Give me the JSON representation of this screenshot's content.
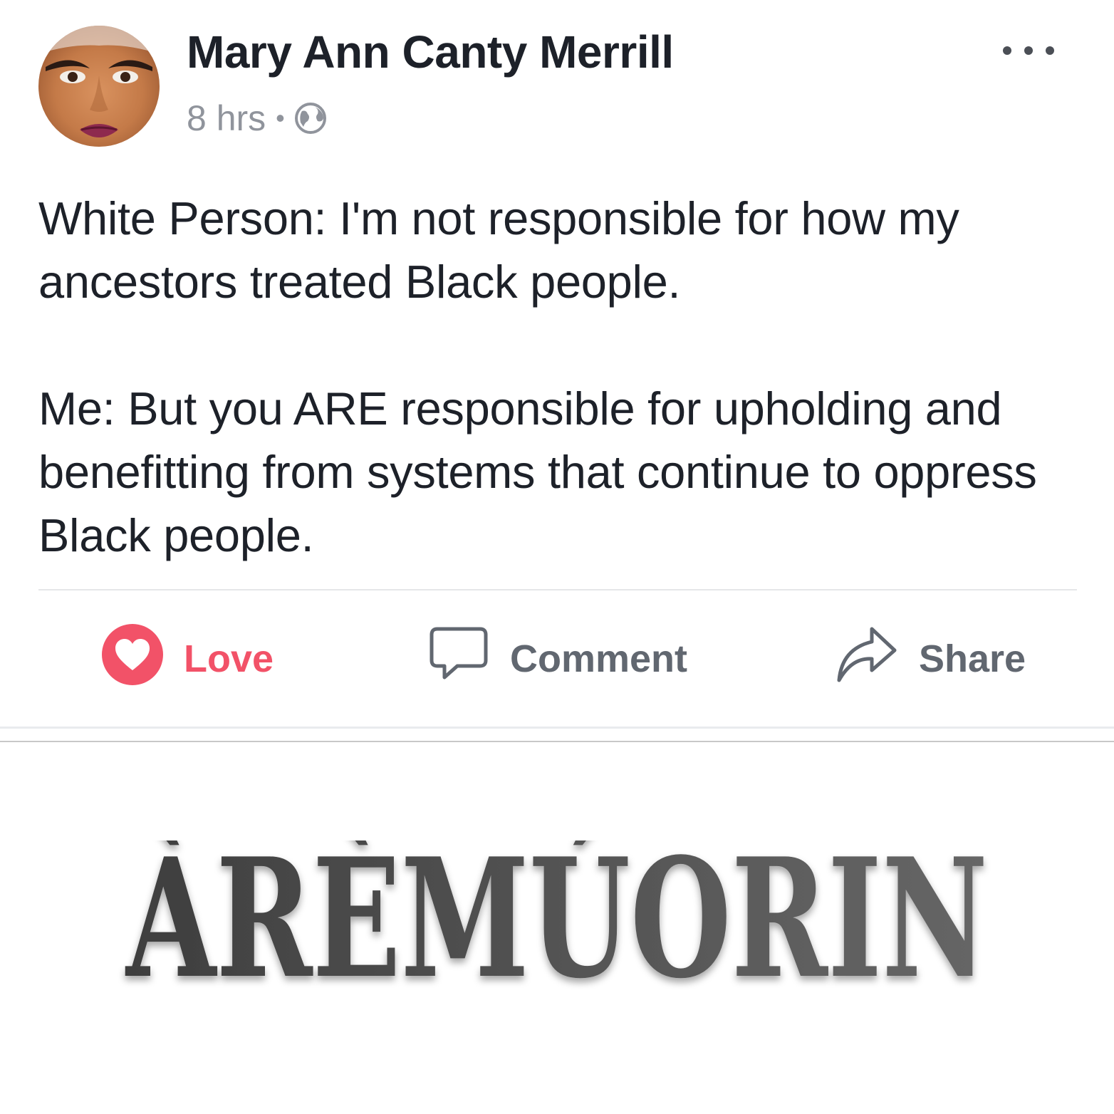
{
  "post": {
    "author": "Mary Ann Canty Merrill",
    "time": "8 hrs",
    "separator": "•",
    "privacy_icon": "globe-icon",
    "more_icon": "more-options-icon",
    "paragraphs": [
      "White Person: I'm not responsible for how my ancestors treated Black people.",
      "Me: But you ARE responsible for upholding and benefitting from systems that continue to oppress Black people."
    ]
  },
  "actions": {
    "love": {
      "label": "Love",
      "icon": "heart-icon",
      "color": "#f25268"
    },
    "comment": {
      "label": "Comment",
      "icon": "comment-bubble-icon"
    },
    "share": {
      "label": "Share",
      "icon": "share-arrow-icon"
    }
  },
  "watermark": {
    "text": "ÀRÈMÚORIN"
  }
}
